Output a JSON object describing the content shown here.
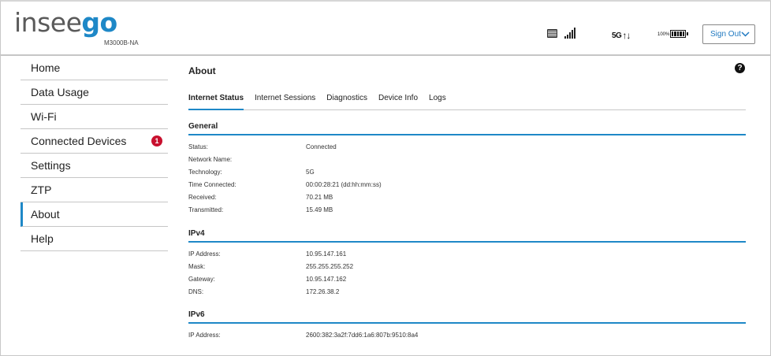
{
  "header": {
    "logo_part1": "insee",
    "logo_part2": "go",
    "model": "M3000B-NA",
    "network": "5G",
    "network_arrows": "↑↓",
    "battery_percent": "100%",
    "signal_bars": 5,
    "sign_out_label": "Sign Out"
  },
  "sidebar": {
    "items": [
      {
        "label": "Home"
      },
      {
        "label": "Data Usage"
      },
      {
        "label": "Wi-Fi"
      },
      {
        "label": "Connected Devices",
        "badge": "1"
      },
      {
        "label": "Settings"
      },
      {
        "label": "ZTP"
      },
      {
        "label": "About",
        "active": true
      },
      {
        "label": "Help"
      }
    ]
  },
  "main": {
    "title": "About",
    "help_label": "?",
    "tabs": [
      {
        "label": "Internet Status",
        "active": true
      },
      {
        "label": "Internet Sessions"
      },
      {
        "label": "Diagnostics"
      },
      {
        "label": "Device Info"
      },
      {
        "label": "Logs"
      }
    ],
    "general": {
      "title": "General",
      "rows": [
        {
          "label": "Status:",
          "value": "Connected"
        },
        {
          "label": "Network Name:",
          "value": ""
        },
        {
          "label": "Technology:",
          "value": "5G"
        },
        {
          "label": "Time Connected:",
          "value": "00:00:28:21 (dd:hh:mm:ss)"
        },
        {
          "label": "Received:",
          "value": "70.21 MB"
        },
        {
          "label": "Transmitted:",
          "value": "15.49 MB"
        }
      ]
    },
    "ipv4": {
      "title": "IPv4",
      "rows": [
        {
          "label": "IP Address:",
          "value": "10.95.147.161"
        },
        {
          "label": "Mask:",
          "value": "255.255.255.252"
        },
        {
          "label": "Gateway:",
          "value": "10.95.147.162"
        },
        {
          "label": "DNS:",
          "value": "172.26.38.2"
        }
      ]
    },
    "ipv6": {
      "title": "IPv6",
      "rows": [
        {
          "label": "IP Address:",
          "value": "2600:382:3a2f:7dd6:1a6:807b:9510:8a4"
        }
      ]
    }
  },
  "colors": {
    "accent": "#1e88c7",
    "badge": "#c8102e",
    "logo_gray": "#5a5a5a"
  }
}
